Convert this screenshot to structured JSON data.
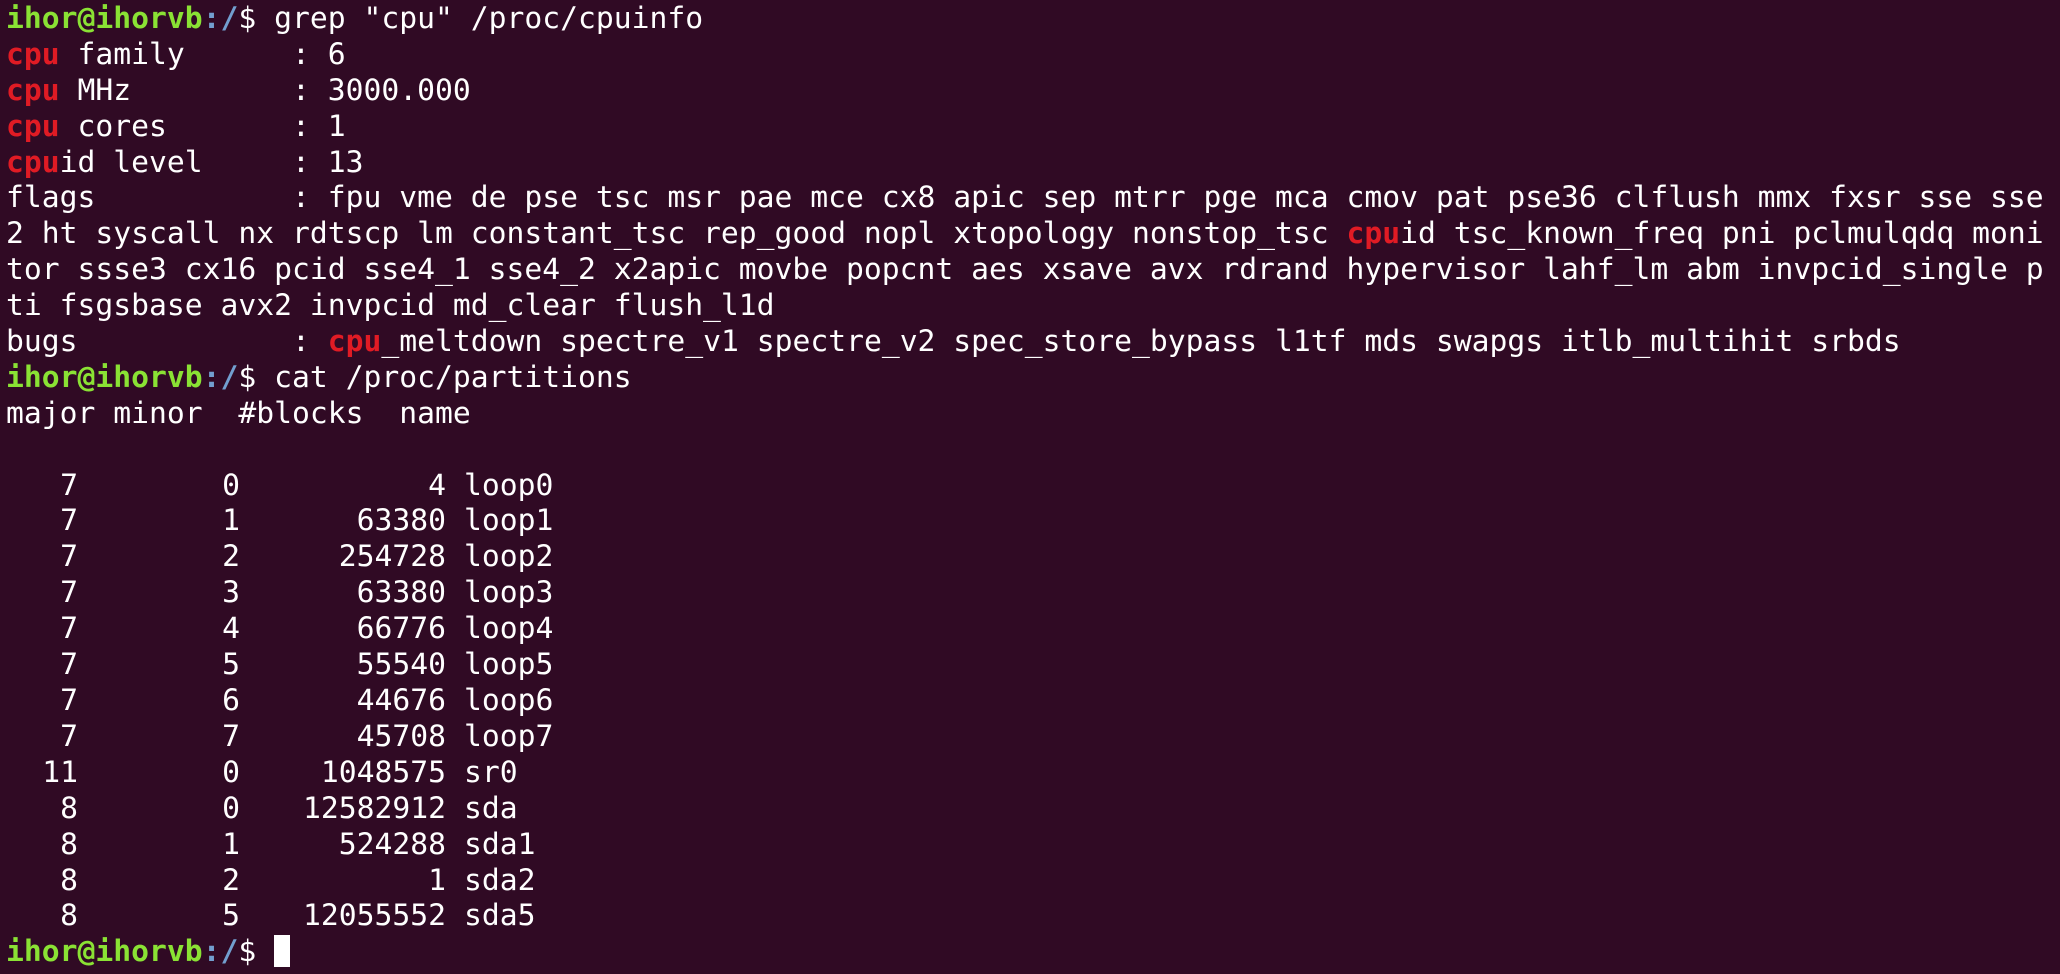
{
  "prompt": {
    "user_host": "ihor@ihorvb",
    "path": ":/",
    "symbol": "$ "
  },
  "commands": {
    "grep": "grep \"cpu\" /proc/cpuinfo",
    "cat": "cat /proc/partitions"
  },
  "cpuinfo": [
    {
      "parts": [
        {
          "t": "cpu",
          "h": true
        },
        {
          "t": " family      : 6",
          "h": false
        }
      ]
    },
    {
      "parts": [
        {
          "t": "cpu",
          "h": true
        },
        {
          "t": " MHz         : 3000.000",
          "h": false
        }
      ]
    },
    {
      "parts": [
        {
          "t": "cpu",
          "h": true
        },
        {
          "t": " cores       : 1",
          "h": false
        }
      ]
    },
    {
      "parts": [
        {
          "t": "cpu",
          "h": true
        },
        {
          "t": "id level     : 13",
          "h": false
        }
      ]
    },
    {
      "parts": [
        {
          "t": "flags           : fpu vme de pse tsc msr pae mce cx8 apic sep mtrr pge mca cmov pat pse36 clflush mmx fxsr sse sse",
          "h": false
        }
      ]
    },
    {
      "parts": [
        {
          "t": "2 ht syscall nx rdtscp lm constant_tsc rep_good nopl xtopology nonstop_tsc ",
          "h": false
        },
        {
          "t": "cpu",
          "h": true
        },
        {
          "t": "id tsc_known_freq pni pclmulqdq moni",
          "h": false
        }
      ]
    },
    {
      "parts": [
        {
          "t": "tor ssse3 cx16 pcid sse4_1 sse4_2 x2apic movbe popcnt aes xsave avx rdrand hypervisor lahf_lm abm invpcid_single p",
          "h": false
        }
      ]
    },
    {
      "parts": [
        {
          "t": "ti fsgsbase avx2 invpcid md_clear flush_l1d",
          "h": false
        }
      ]
    },
    {
      "parts": [
        {
          "t": "bugs            : ",
          "h": false
        },
        {
          "t": "cpu",
          "h": true
        },
        {
          "t": "_meltdown spectre_v1 spectre_v2 spec_store_bypass l1tf mds swapgs itlb_multihit srbds",
          "h": false
        }
      ]
    }
  ],
  "partitions": {
    "header": "major minor  #blocks  name",
    "rows": [
      {
        "major": "7",
        "minor": "0",
        "blocks": "4",
        "name": "loop0"
      },
      {
        "major": "7",
        "minor": "1",
        "blocks": "63380",
        "name": "loop1"
      },
      {
        "major": "7",
        "minor": "2",
        "blocks": "254728",
        "name": "loop2"
      },
      {
        "major": "7",
        "minor": "3",
        "blocks": "63380",
        "name": "loop3"
      },
      {
        "major": "7",
        "minor": "4",
        "blocks": "66776",
        "name": "loop4"
      },
      {
        "major": "7",
        "minor": "5",
        "blocks": "55540",
        "name": "loop5"
      },
      {
        "major": "7",
        "minor": "6",
        "blocks": "44676",
        "name": "loop6"
      },
      {
        "major": "7",
        "minor": "7",
        "blocks": "45708",
        "name": "loop7"
      },
      {
        "major": "11",
        "minor": "0",
        "blocks": "1048575",
        "name": "sr0"
      },
      {
        "major": "8",
        "minor": "0",
        "blocks": "12582912",
        "name": "sda"
      },
      {
        "major": "8",
        "minor": "1",
        "blocks": "524288",
        "name": "sda1"
      },
      {
        "major": "8",
        "minor": "2",
        "blocks": "1",
        "name": "sda2"
      },
      {
        "major": "8",
        "minor": "5",
        "blocks": "12055552",
        "name": "sda5"
      }
    ]
  },
  "colors": {
    "background": "#300a24",
    "text": "#ffffff",
    "prompt_user": "#8ae234",
    "prompt_path": "#729fcf",
    "grep_match": "#e01b24"
  }
}
